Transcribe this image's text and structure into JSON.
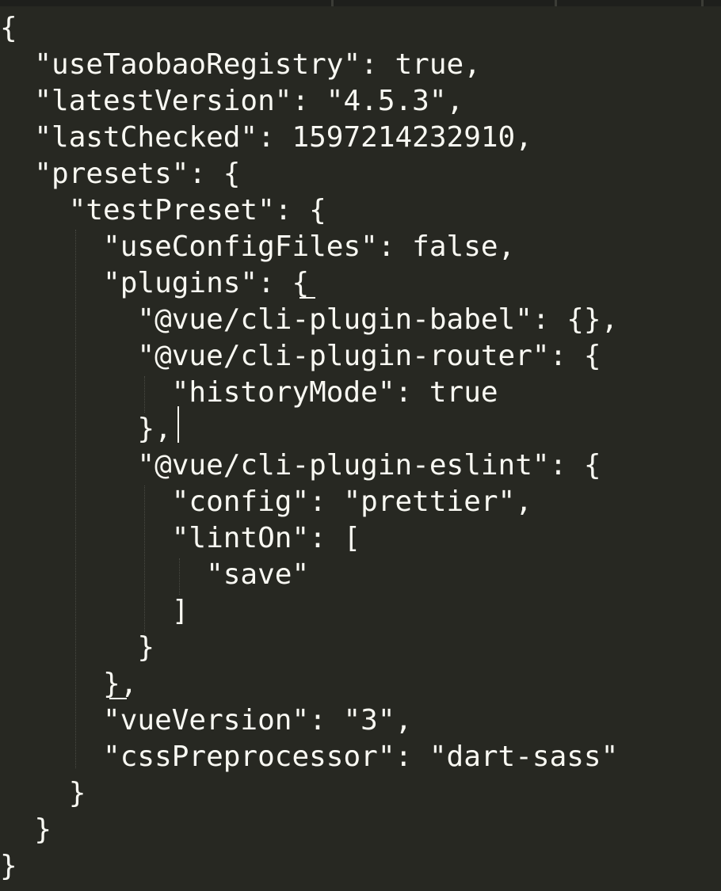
{
  "editor": {
    "theme_colors": {
      "background": "#272822",
      "text": "#f8f8f2",
      "indent_guide": "#4a4b44"
    },
    "lines": [
      "{",
      "  \"useTaobaoRegistry\": true,",
      "  \"latestVersion\": \"4.5.3\",",
      "  \"lastChecked\": 1597214232910,",
      "  \"presets\": {",
      "    \"testPreset\": {",
      "      \"useConfigFiles\": false,",
      "      \"plugins\": {",
      "        \"@vue/cli-plugin-babel\": {},",
      "        \"@vue/cli-plugin-router\": {",
      "          \"historyMode\": true",
      "        },",
      "        \"@vue/cli-plugin-eslint\": {",
      "          \"config\": \"prettier\",",
      "          \"lintOn\": [",
      "            \"save\"",
      "          ]",
      "        }",
      "      },",
      "      \"vueVersion\": \"3\",",
      "      \"cssPreprocessor\": \"dart-sass\"",
      "    }",
      "  }",
      "}"
    ]
  }
}
